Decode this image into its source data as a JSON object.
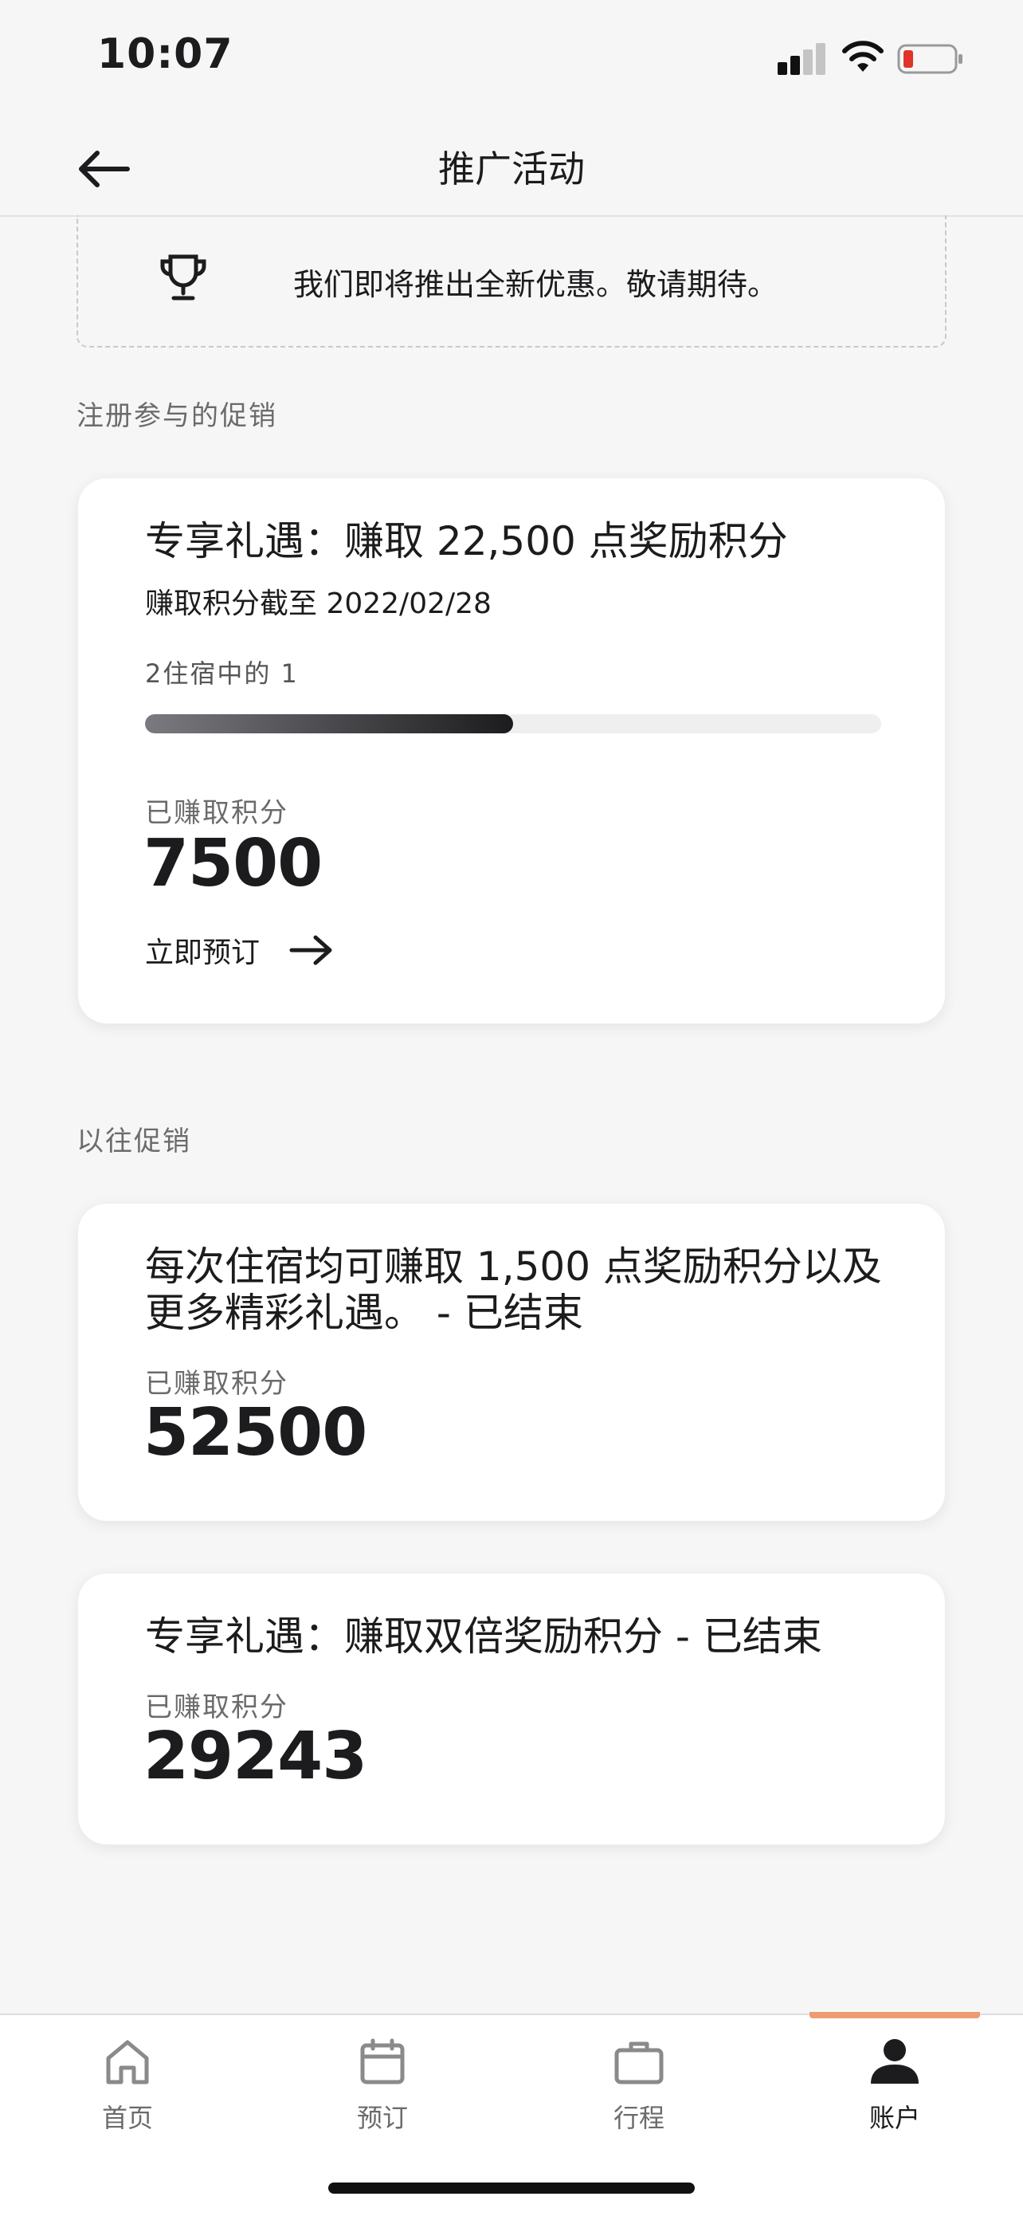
{
  "status_bar": {
    "time": "10:07"
  },
  "nav": {
    "title": "推广活动"
  },
  "notice": {
    "text": "我们即将推出全新优惠。敬请期待。"
  },
  "sections": {
    "enrolled": "注册参与的促销",
    "past": "以往促销"
  },
  "enrolled_promo": {
    "title": "专享礼遇：赚取 22,500 点奖励积分",
    "deadline": "赚取积分截至 2022/02/28",
    "progress_label": "2住宿中的 1",
    "progress_fraction": 0.5,
    "earned_label": "已赚取积分",
    "earned_value": "7500",
    "book_label": "立即预订"
  },
  "past_promos": [
    {
      "title": "每次住宿均可赚取 1,500 点奖励积分以及更多精彩礼遇。 - 已结束",
      "earned_label": "已赚取积分",
      "earned_value": "52500"
    },
    {
      "title": "专享礼遇：赚取双倍奖励积分 - 已结束",
      "earned_label": "已赚取积分",
      "earned_value": "29243"
    }
  ],
  "tabs": [
    {
      "label": "首页",
      "icon": "home-icon"
    },
    {
      "label": "预订",
      "icon": "calendar-icon"
    },
    {
      "label": "行程",
      "icon": "briefcase-icon"
    },
    {
      "label": "账户",
      "icon": "person-icon",
      "active": true
    }
  ],
  "colors": {
    "accent": "#ef9b72",
    "progress": "#1c1c1e",
    "background": "#f6f6f6"
  }
}
